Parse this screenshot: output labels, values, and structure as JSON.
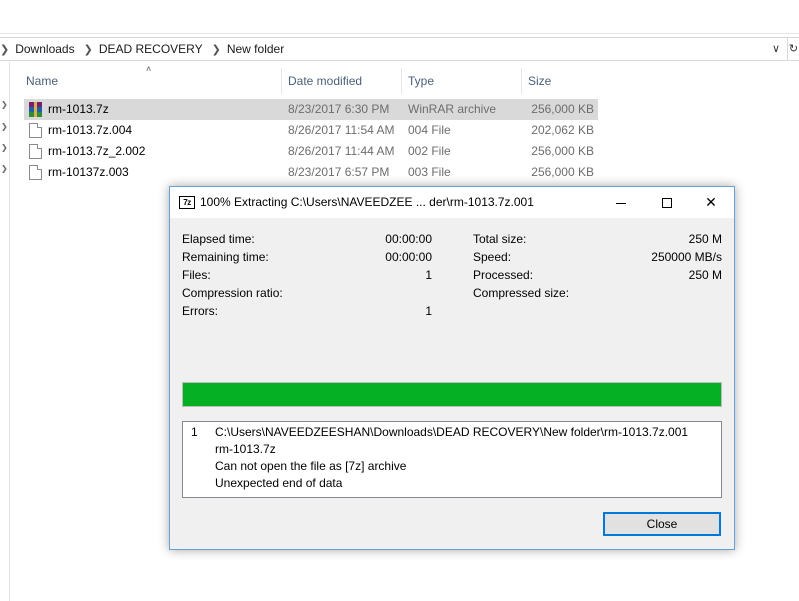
{
  "explorer": {
    "breadcrumbs": [
      "Downloads",
      "DEAD RECOVERY",
      "New folder"
    ],
    "columns": {
      "name": "Name",
      "date": "Date modified",
      "type": "Type",
      "size": "Size"
    },
    "files": [
      {
        "name": "rm-1013.7z",
        "date": "8/23/2017 6:30 PM",
        "type": "WinRAR archive",
        "size": "256,000 KB",
        "icon": "winrar-archive-icon",
        "selected": true
      },
      {
        "name": "rm-1013.7z.004",
        "date": "8/26/2017 11:54 AM",
        "type": "004 File",
        "size": "202,062 KB",
        "icon": "file-icon",
        "selected": false
      },
      {
        "name": "rm-1013.7z_2.002",
        "date": "8/26/2017 11:44 AM",
        "type": "002 File",
        "size": "256,000 KB",
        "icon": "file-icon",
        "selected": false
      },
      {
        "name": "rm-10137z.003",
        "date": "8/23/2017 6:57 PM",
        "type": "003 File",
        "size": "256,000 KB",
        "icon": "file-icon",
        "selected": false
      }
    ]
  },
  "dialog": {
    "app_icon_text": "7z",
    "title": "100% Extracting C:\\Users\\NAVEEDZEE ... der\\rm-1013.7z.001",
    "left_stats": [
      {
        "label": "Elapsed time:",
        "value": "00:00:00"
      },
      {
        "label": "Remaining time:",
        "value": "00:00:00"
      },
      {
        "label": "Files:",
        "value": "1"
      },
      {
        "label": "Compression ratio:",
        "value": ""
      },
      {
        "label": "Errors:",
        "value": "1"
      }
    ],
    "right_stats": [
      {
        "label": "Total size:",
        "value": "250 M"
      },
      {
        "label": "Speed:",
        "value": "250000 MB/s"
      },
      {
        "label": "Processed:",
        "value": "250 M"
      },
      {
        "label": "Compressed size:",
        "value": ""
      }
    ],
    "progress_percent": 100,
    "progress_color": "#06b025",
    "messages": {
      "number": "1",
      "lines": [
        "C:\\Users\\NAVEEDZEESHAN\\Downloads\\DEAD RECOVERY\\New folder\\rm-1013.7z.001",
        "rm-1013.7z",
        "Can not open the file as [7z] archive",
        "Unexpected end of data"
      ]
    },
    "close_label": "Close"
  }
}
